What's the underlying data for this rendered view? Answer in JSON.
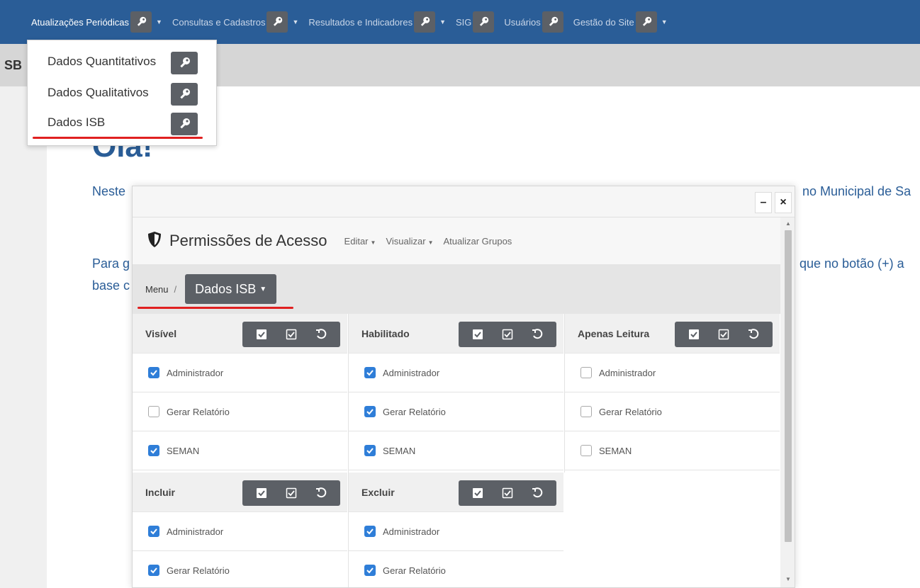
{
  "nav": {
    "items": [
      {
        "label": "Atualizações Periódicas"
      },
      {
        "label": "Consultas e Cadastros"
      },
      {
        "label": "Resultados e Indicadores"
      },
      {
        "label": "SIG"
      },
      {
        "label": "Usuários"
      },
      {
        "label": "Gestão do Site"
      }
    ]
  },
  "strip": {
    "left_text": "SB"
  },
  "dropdown": {
    "items": [
      {
        "label": "Dados Quantitativos"
      },
      {
        "label": "Dados Qualitativos"
      },
      {
        "label": "Dados ISB"
      }
    ]
  },
  "page": {
    "heading": "Olá!",
    "para1_left": "Neste",
    "para1_right": "no Municipal de Sa",
    "para2_left": "Para g",
    "para2_right": "que no botão (+) a",
    "para3_left": "base c"
  },
  "modal": {
    "minimize": "–",
    "close": "×",
    "title": "Permissões de Acesso",
    "menus": [
      "Editar",
      "Visualizar",
      "Atualizar Grupos"
    ],
    "breadcrumb": {
      "root": "Menu",
      "sep": "/",
      "current": "Dados ISB"
    },
    "panels": [
      {
        "title": "Visível",
        "rows": [
          {
            "label": "Administrador",
            "checked": true
          },
          {
            "label": "Gerar Relatório",
            "checked": false
          },
          {
            "label": "SEMAN",
            "checked": true
          }
        ]
      },
      {
        "title": "Habilitado",
        "rows": [
          {
            "label": "Administrador",
            "checked": true
          },
          {
            "label": "Gerar Relatório",
            "checked": true
          },
          {
            "label": "SEMAN",
            "checked": true
          }
        ]
      },
      {
        "title": "Apenas Leitura",
        "rows": [
          {
            "label": "Administrador",
            "checked": false
          },
          {
            "label": "Gerar Relatório",
            "checked": false
          },
          {
            "label": "SEMAN",
            "checked": false
          }
        ]
      },
      {
        "title": "Incluir",
        "rows": [
          {
            "label": "Administrador",
            "checked": true
          },
          {
            "label": "Gerar Relatório",
            "checked": true
          }
        ]
      },
      {
        "title": "Excluir",
        "rows": [
          {
            "label": "Administrador",
            "checked": true
          },
          {
            "label": "Gerar Relatório",
            "checked": true
          }
        ]
      }
    ]
  },
  "colors": {
    "navbar": "#2a5d97",
    "button_dark": "#5c6066",
    "checkbox_on": "#2f7ed8",
    "highlight_underline": "#e02020"
  }
}
